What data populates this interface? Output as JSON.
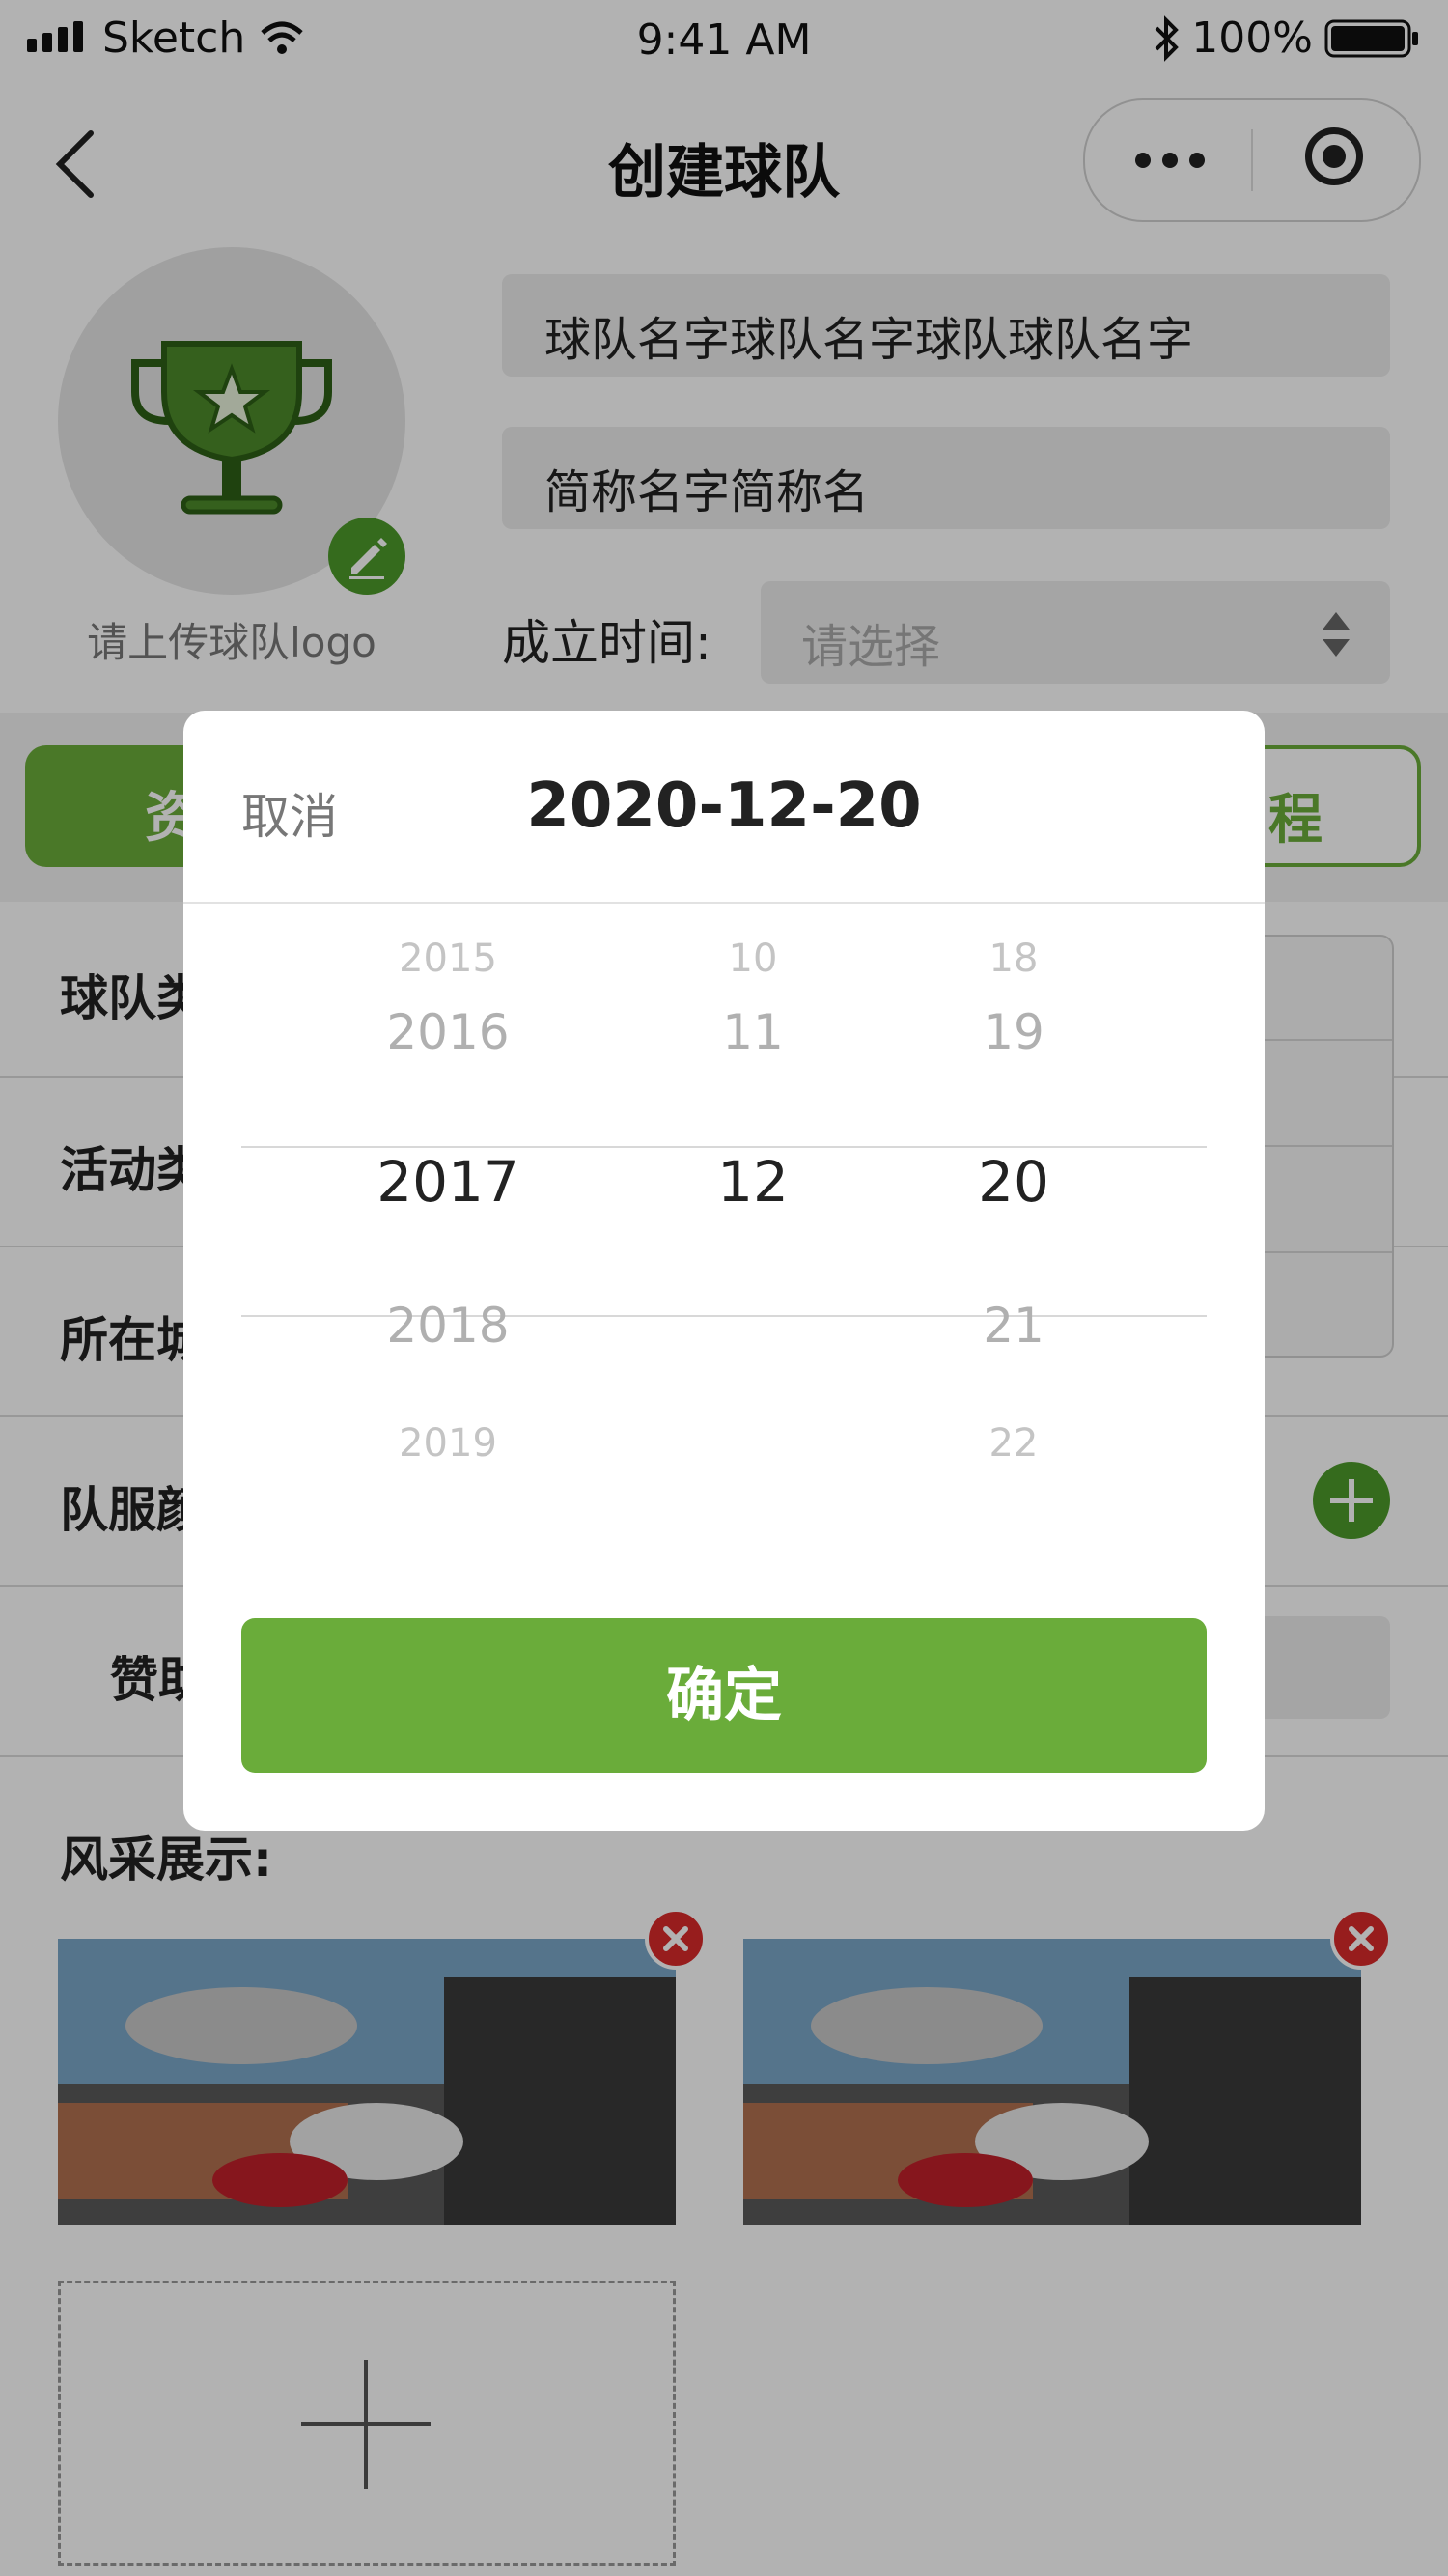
{
  "status_bar": {
    "carrier": "Sketch",
    "time": "9:41 AM",
    "battery": "100%"
  },
  "nav": {
    "title": "创建球队"
  },
  "logo": {
    "label": "请上传球队logo"
  },
  "fields": {
    "team_name": "球队名字球队名字球队球队名字",
    "short_name": "简称名字简称名",
    "founded_label": "成立时间:",
    "founded_placeholder": "请选择"
  },
  "tabs": {
    "left_partial": "资",
    "right_partial": "程"
  },
  "rows": {
    "team_type_partial": "球队类",
    "activity_partial": "活动类",
    "city_partial": "所在城",
    "uniform_partial": "队服颜",
    "sponsor_partial": "赞助"
  },
  "gallery": {
    "title": "风采展示:"
  },
  "picker": {
    "cancel": "取消",
    "title": "2020-12-20",
    "confirm": "确定",
    "years": [
      "2015",
      "2016",
      "2017",
      "2018",
      "2019"
    ],
    "months": [
      "10",
      "11",
      "12"
    ],
    "days": [
      "18",
      "19",
      "20",
      "21",
      "22"
    ]
  },
  "colors": {
    "accent": "#6aac3a",
    "dark_green": "#4c9a2a",
    "close_red": "#d92a2a"
  }
}
